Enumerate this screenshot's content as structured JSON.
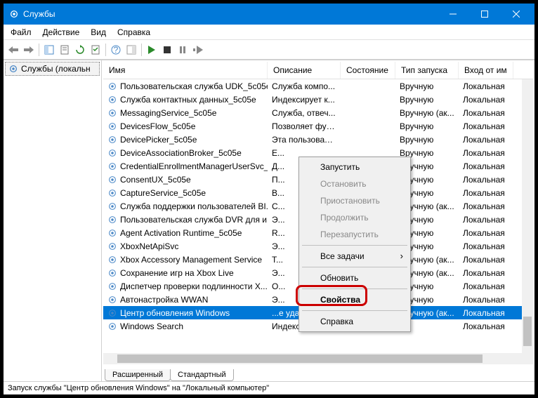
{
  "window": {
    "title": "Службы"
  },
  "menu": {
    "file": "Файл",
    "action": "Действие",
    "view": "Вид",
    "help": "Справка"
  },
  "tree": {
    "root": "Службы (локальн"
  },
  "columns": {
    "name": "Имя",
    "desc": "Описание",
    "state": "Состояние",
    "startup": "Тип запуска",
    "logon": "Вход от им"
  },
  "rows": [
    {
      "name": "Пользовательская служба UDK_5c05e",
      "desc": "Служба компо...",
      "state": "",
      "startup": "Вручную",
      "logon": "Локальная"
    },
    {
      "name": "Служба контактных данных_5c05e",
      "desc": "Индексирует к...",
      "state": "",
      "startup": "Вручную",
      "logon": "Локальная"
    },
    {
      "name": "MessagingService_5c05e",
      "desc": "Служба, отвеч...",
      "state": "",
      "startup": "Вручную (ак...",
      "logon": "Локальная"
    },
    {
      "name": "DevicesFlow_5c05e",
      "desc": "Позволяет фун...",
      "state": "",
      "startup": "Вручную",
      "logon": "Локальная"
    },
    {
      "name": "DevicePicker_5c05e",
      "desc": "Эта пользовате...",
      "state": "",
      "startup": "Вручную",
      "logon": "Локальная"
    },
    {
      "name": "DeviceAssociationBroker_5c05e",
      "desc": "E...",
      "state": "",
      "startup": "Вручную",
      "logon": "Локальная"
    },
    {
      "name": "CredentialEnrollmentManagerUserSvc_...",
      "desc": "Д...",
      "state": "",
      "startup": "Вручную",
      "logon": "Локальная"
    },
    {
      "name": "ConsentUX_5c05e",
      "desc": "П...",
      "state": "",
      "startup": "Вручную",
      "logon": "Локальная"
    },
    {
      "name": "CaptureService_5c05e",
      "desc": "В...",
      "state": "",
      "startup": "Вручную",
      "logon": "Локальная"
    },
    {
      "name": "Служба поддержки пользователей BI...",
      "desc": "С...",
      "state": "",
      "startup": "Вручную (ак...",
      "logon": "Локальная"
    },
    {
      "name": "Пользовательская служба DVR для и...",
      "desc": "Э...",
      "state": "",
      "startup": "Вручную",
      "logon": "Локальная"
    },
    {
      "name": "Agent Activation Runtime_5c05e",
      "desc": "R...",
      "state": "",
      "startup": "Вручную",
      "logon": "Локальная"
    },
    {
      "name": "XboxNetApiSvc",
      "desc": "Э...",
      "state": "",
      "startup": "Вручную",
      "logon": "Локальная"
    },
    {
      "name": "Xbox Accessory Management Service",
      "desc": "T...",
      "state": "",
      "startup": "Вручную (ак...",
      "logon": "Локальная"
    },
    {
      "name": "Сохранение игр на Xbox Live",
      "desc": "Э...",
      "state": "",
      "startup": "Вручную (ак...",
      "logon": "Локальная"
    },
    {
      "name": "Диспетчер проверки подлинности X...",
      "desc": "О...",
      "state": "",
      "startup": "Вручную",
      "logon": "Локальная"
    },
    {
      "name": "Автонастройка WWAN",
      "desc": "Э...",
      "state": "",
      "startup": "Вручную",
      "logon": "Локальная"
    },
    {
      "name": "Центр обновления Windows",
      "desc": "...е удастся пр...",
      "state": "",
      "startup": "Вручную (ак...",
      "logon": "Локальная",
      "selected": true
    },
    {
      "name": "Windows Search",
      "desc": "Индексирован...",
      "state": "",
      "startup": "",
      "logon": "Локальная"
    }
  ],
  "context": {
    "start": "Запустить",
    "stop": "Остановить",
    "pause": "Приостановить",
    "resume": "Продолжить",
    "restart": "Перезапустить",
    "alltasks": "Все задачи",
    "refresh": "Обновить",
    "properties": "Свойства",
    "help": "Справка"
  },
  "tabs": {
    "extended": "Расширенный",
    "standard": "Стандартный"
  },
  "status": "Запуск службы \"Центр обновления Windows\" на \"Локальный компьютер\""
}
